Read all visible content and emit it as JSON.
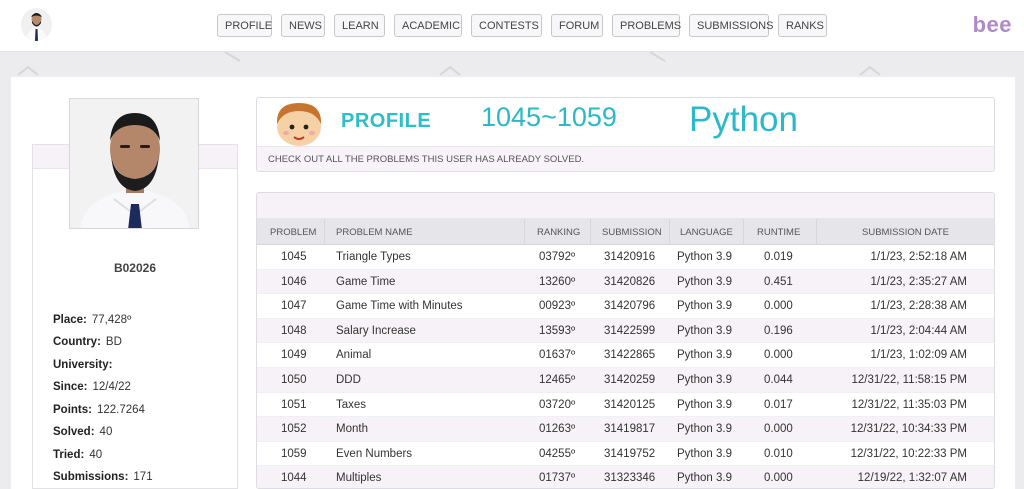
{
  "nav": {
    "items": [
      "PROFILE",
      "NEWS",
      "LEARN",
      "ACADEMIC",
      "CONTESTS",
      "FORUM",
      "PROBLEMS",
      "SUBMISSIONS",
      "RANKS"
    ],
    "brand": "bee"
  },
  "profile": {
    "username": "B02026",
    "fields": [
      {
        "label": "Place:",
        "value": "77,428º"
      },
      {
        "label": "Country:",
        "value": "BD"
      },
      {
        "label": "University:",
        "value": ""
      },
      {
        "label": "Since:",
        "value": "12/4/22"
      },
      {
        "label": "Points:",
        "value": "122.7264"
      },
      {
        "label": "Solved:",
        "value": "40"
      },
      {
        "label": "Tried:",
        "value": "40"
      },
      {
        "label": "Submissions:",
        "value": "171"
      }
    ]
  },
  "banner": {
    "title": "PROFILE",
    "range": "1045~1059",
    "language": "Python",
    "subtitle": "CHECK OUT ALL THE PROBLEMS THIS USER HAS ALREADY SOLVED."
  },
  "table": {
    "headers": [
      "PROBLEM",
      "PROBLEM NAME",
      "RANKING",
      "SUBMISSION",
      "LANGUAGE",
      "RUNTIME",
      "SUBMISSION DATE"
    ],
    "rows": [
      [
        "1045",
        "Triangle Types",
        "03792º",
        "31420916",
        "Python 3.9",
        "0.019",
        "1/1/23, 2:52:18 AM"
      ],
      [
        "1046",
        "Game Time",
        "13260º",
        "31420826",
        "Python 3.9",
        "0.451",
        "1/1/23, 2:35:27 AM"
      ],
      [
        "1047",
        "Game Time with Minutes",
        "00923º",
        "31420796",
        "Python 3.9",
        "0.000",
        "1/1/23, 2:28:38 AM"
      ],
      [
        "1048",
        "Salary Increase",
        "13593º",
        "31422599",
        "Python 3.9",
        "0.196",
        "1/1/23, 2:04:44 AM"
      ],
      [
        "1049",
        "Animal",
        "01637º",
        "31422865",
        "Python 3.9",
        "0.000",
        "1/1/23, 1:02:09 AM"
      ],
      [
        "1050",
        "DDD",
        "12465º",
        "31420259",
        "Python 3.9",
        "0.044",
        "12/31/22, 11:58:15 PM"
      ],
      [
        "1051",
        "Taxes",
        "03720º",
        "31420125",
        "Python 3.9",
        "0.017",
        "12/31/22, 11:35:03 PM"
      ],
      [
        "1052",
        "Month",
        "01263º",
        "31419817",
        "Python 3.9",
        "0.000",
        "12/31/22, 10:34:33 PM"
      ],
      [
        "1059",
        "Even Numbers",
        "04255º",
        "31419752",
        "Python 3.9",
        "0.010",
        "12/31/22, 10:22:33 PM"
      ],
      [
        "1044",
        "Multiples",
        "01737º",
        "31323346",
        "Python 3.9",
        "0.000",
        "12/19/22, 1:32:07 AM"
      ]
    ]
  }
}
